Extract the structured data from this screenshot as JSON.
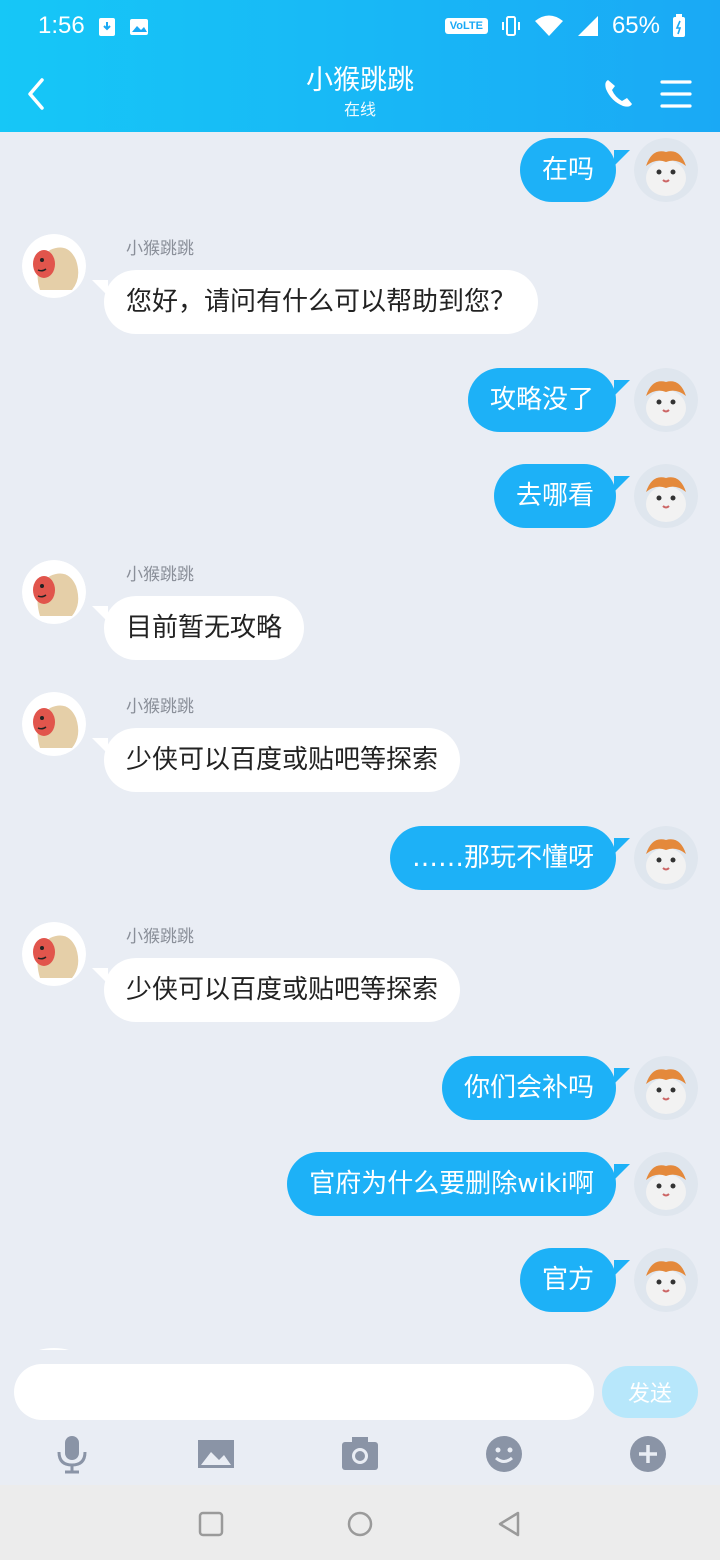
{
  "status_bar": {
    "time": "1:56",
    "volte": "VoLTE",
    "battery": "65%"
  },
  "header": {
    "title": "小猴跳跳",
    "status": "在线"
  },
  "messages": [
    {
      "dir": "out",
      "text": "在吗"
    },
    {
      "dir": "in",
      "sender": "小猴跳跳",
      "text": "您好，请问有什么可以帮助到您？"
    },
    {
      "dir": "out",
      "text": "攻略没了"
    },
    {
      "dir": "out",
      "text": "去哪看"
    },
    {
      "dir": "in",
      "sender": "小猴跳跳",
      "text": "目前暂无攻略"
    },
    {
      "dir": "in",
      "sender": "小猴跳跳",
      "text": "少侠可以百度或贴吧等探索"
    },
    {
      "dir": "out",
      "text": "……那玩不懂呀"
    },
    {
      "dir": "in",
      "sender": "小猴跳跳",
      "text": "少侠可以百度或贴吧等探索"
    },
    {
      "dir": "out",
      "text": "你们会补吗"
    },
    {
      "dir": "out",
      "text": "官府为什么要删除wiki啊"
    },
    {
      "dir": "out",
      "text": "官方"
    }
  ],
  "input": {
    "placeholder": "",
    "send_label": "发送"
  },
  "colors": {
    "header_start": "#16c7f7",
    "header_end": "#1aa9f5",
    "bubble_out": "#1db1f7",
    "bubble_in": "#ffffff",
    "background": "#e9edf4"
  }
}
